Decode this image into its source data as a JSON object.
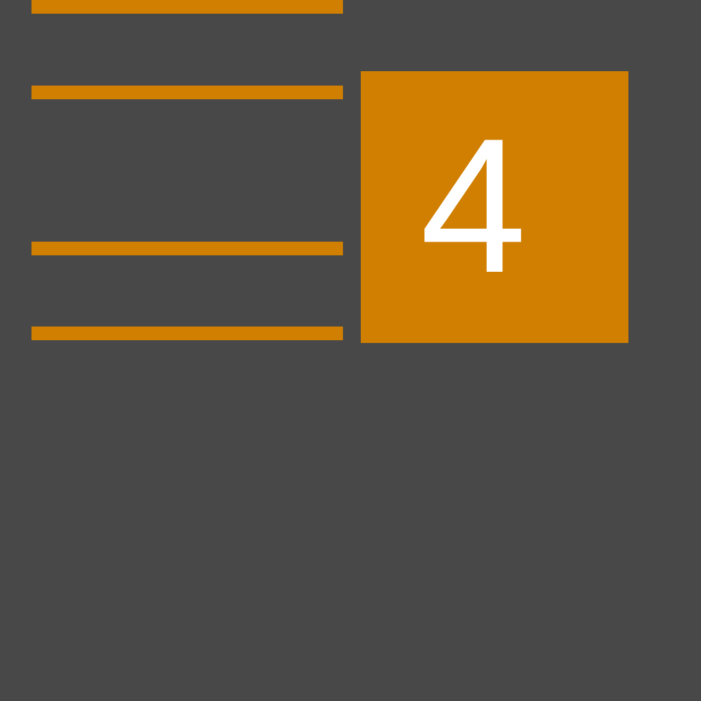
{
  "theme": {
    "background": "#484848",
    "accent": "#d17f00",
    "text": "#ffffff"
  },
  "stripes": [
    {
      "name": "stripe-1"
    },
    {
      "name": "stripe-2"
    },
    {
      "name": "stripe-3"
    },
    {
      "name": "stripe-4"
    }
  ],
  "tile": {
    "number": "4"
  }
}
